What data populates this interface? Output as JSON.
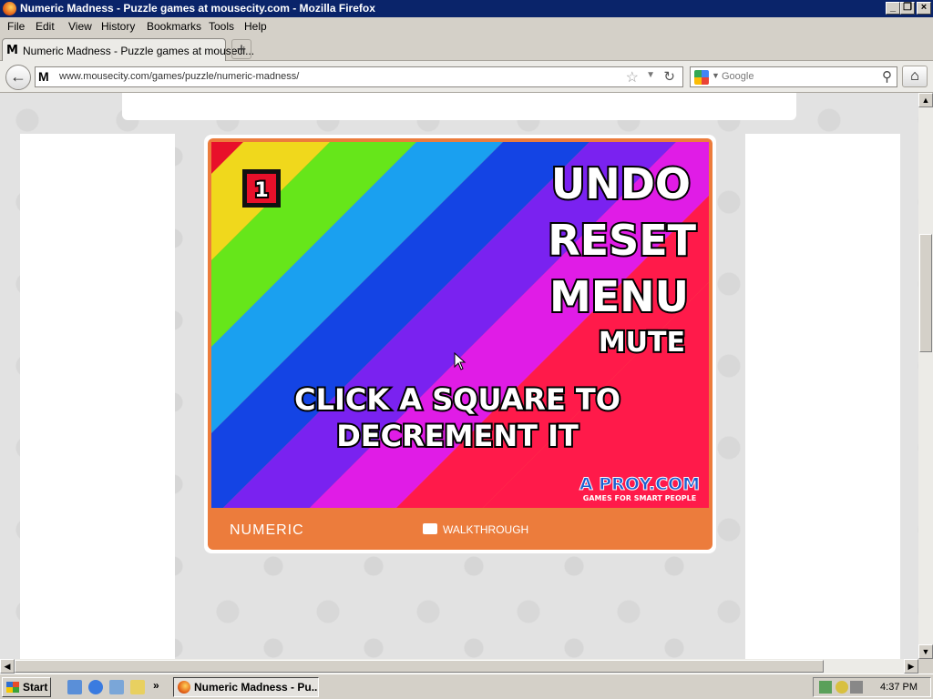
{
  "window": {
    "title": "Numeric Madness - Puzzle games at mousecity.com - Mozilla Firefox"
  },
  "menu": [
    "File",
    "Edit",
    "View",
    "History",
    "Bookmarks",
    "Tools",
    "Help"
  ],
  "tab": {
    "label": "Numeric Madness - Puzzle games at mouseci...",
    "new_tab": "+"
  },
  "nav": {
    "url": "www.mousecity.com/games/puzzle/numeric-madness/",
    "search_placeholder": "Google"
  },
  "game": {
    "counter": "1",
    "buttons": [
      "UNDO",
      "RESET",
      "MENU",
      "MUTE"
    ],
    "instruction_line1": "CLICK A SQUARE TO",
    "instruction_line2": "DECREMENT IT",
    "brand": "A PROY.COM",
    "brand_tagline": "GAMES FOR SMART PEOPLE",
    "stripe_colors": [
      "#e8102a",
      "#f0d81c",
      "#66e61a",
      "#1aa0f0",
      "#1444e4",
      "#7a22f0",
      "#e01ce6",
      "#ff1a4a"
    ]
  },
  "gamebar": {
    "title": "NUMERIC",
    "walkthrough": "WALKTHROUGH"
  },
  "taskbar": {
    "start": "Start",
    "task": "Numeric Madness - Pu...",
    "clock": "4:37 PM"
  }
}
